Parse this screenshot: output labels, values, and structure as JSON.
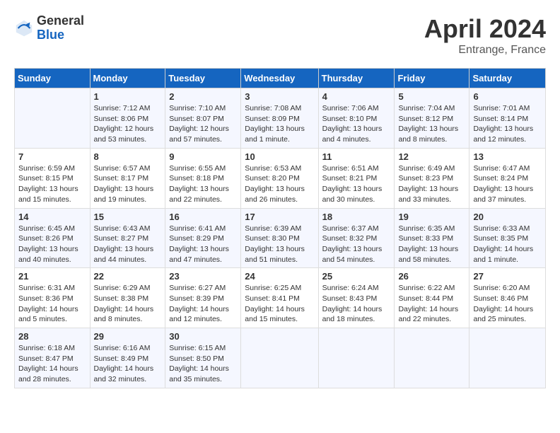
{
  "header": {
    "logo_general": "General",
    "logo_blue": "Blue",
    "month_title": "April 2024",
    "location": "Entrange, France"
  },
  "days_of_week": [
    "Sunday",
    "Monday",
    "Tuesday",
    "Wednesday",
    "Thursday",
    "Friday",
    "Saturday"
  ],
  "weeks": [
    [
      {
        "day": "",
        "info": ""
      },
      {
        "day": "1",
        "info": "Sunrise: 7:12 AM\nSunset: 8:06 PM\nDaylight: 12 hours\nand 53 minutes."
      },
      {
        "day": "2",
        "info": "Sunrise: 7:10 AM\nSunset: 8:07 PM\nDaylight: 12 hours\nand 57 minutes."
      },
      {
        "day": "3",
        "info": "Sunrise: 7:08 AM\nSunset: 8:09 PM\nDaylight: 13 hours\nand 1 minute."
      },
      {
        "day": "4",
        "info": "Sunrise: 7:06 AM\nSunset: 8:10 PM\nDaylight: 13 hours\nand 4 minutes."
      },
      {
        "day": "5",
        "info": "Sunrise: 7:04 AM\nSunset: 8:12 PM\nDaylight: 13 hours\nand 8 minutes."
      },
      {
        "day": "6",
        "info": "Sunrise: 7:01 AM\nSunset: 8:14 PM\nDaylight: 13 hours\nand 12 minutes."
      }
    ],
    [
      {
        "day": "7",
        "info": "Sunrise: 6:59 AM\nSunset: 8:15 PM\nDaylight: 13 hours\nand 15 minutes."
      },
      {
        "day": "8",
        "info": "Sunrise: 6:57 AM\nSunset: 8:17 PM\nDaylight: 13 hours\nand 19 minutes."
      },
      {
        "day": "9",
        "info": "Sunrise: 6:55 AM\nSunset: 8:18 PM\nDaylight: 13 hours\nand 22 minutes."
      },
      {
        "day": "10",
        "info": "Sunrise: 6:53 AM\nSunset: 8:20 PM\nDaylight: 13 hours\nand 26 minutes."
      },
      {
        "day": "11",
        "info": "Sunrise: 6:51 AM\nSunset: 8:21 PM\nDaylight: 13 hours\nand 30 minutes."
      },
      {
        "day": "12",
        "info": "Sunrise: 6:49 AM\nSunset: 8:23 PM\nDaylight: 13 hours\nand 33 minutes."
      },
      {
        "day": "13",
        "info": "Sunrise: 6:47 AM\nSunset: 8:24 PM\nDaylight: 13 hours\nand 37 minutes."
      }
    ],
    [
      {
        "day": "14",
        "info": "Sunrise: 6:45 AM\nSunset: 8:26 PM\nDaylight: 13 hours\nand 40 minutes."
      },
      {
        "day": "15",
        "info": "Sunrise: 6:43 AM\nSunset: 8:27 PM\nDaylight: 13 hours\nand 44 minutes."
      },
      {
        "day": "16",
        "info": "Sunrise: 6:41 AM\nSunset: 8:29 PM\nDaylight: 13 hours\nand 47 minutes."
      },
      {
        "day": "17",
        "info": "Sunrise: 6:39 AM\nSunset: 8:30 PM\nDaylight: 13 hours\nand 51 minutes."
      },
      {
        "day": "18",
        "info": "Sunrise: 6:37 AM\nSunset: 8:32 PM\nDaylight: 13 hours\nand 54 minutes."
      },
      {
        "day": "19",
        "info": "Sunrise: 6:35 AM\nSunset: 8:33 PM\nDaylight: 13 hours\nand 58 minutes."
      },
      {
        "day": "20",
        "info": "Sunrise: 6:33 AM\nSunset: 8:35 PM\nDaylight: 14 hours\nand 1 minute."
      }
    ],
    [
      {
        "day": "21",
        "info": "Sunrise: 6:31 AM\nSunset: 8:36 PM\nDaylight: 14 hours\nand 5 minutes."
      },
      {
        "day": "22",
        "info": "Sunrise: 6:29 AM\nSunset: 8:38 PM\nDaylight: 14 hours\nand 8 minutes."
      },
      {
        "day": "23",
        "info": "Sunrise: 6:27 AM\nSunset: 8:39 PM\nDaylight: 14 hours\nand 12 minutes."
      },
      {
        "day": "24",
        "info": "Sunrise: 6:25 AM\nSunset: 8:41 PM\nDaylight: 14 hours\nand 15 minutes."
      },
      {
        "day": "25",
        "info": "Sunrise: 6:24 AM\nSunset: 8:43 PM\nDaylight: 14 hours\nand 18 minutes."
      },
      {
        "day": "26",
        "info": "Sunrise: 6:22 AM\nSunset: 8:44 PM\nDaylight: 14 hours\nand 22 minutes."
      },
      {
        "day": "27",
        "info": "Sunrise: 6:20 AM\nSunset: 8:46 PM\nDaylight: 14 hours\nand 25 minutes."
      }
    ],
    [
      {
        "day": "28",
        "info": "Sunrise: 6:18 AM\nSunset: 8:47 PM\nDaylight: 14 hours\nand 28 minutes."
      },
      {
        "day": "29",
        "info": "Sunrise: 6:16 AM\nSunset: 8:49 PM\nDaylight: 14 hours\nand 32 minutes."
      },
      {
        "day": "30",
        "info": "Sunrise: 6:15 AM\nSunset: 8:50 PM\nDaylight: 14 hours\nand 35 minutes."
      },
      {
        "day": "",
        "info": ""
      },
      {
        "day": "",
        "info": ""
      },
      {
        "day": "",
        "info": ""
      },
      {
        "day": "",
        "info": ""
      }
    ]
  ]
}
